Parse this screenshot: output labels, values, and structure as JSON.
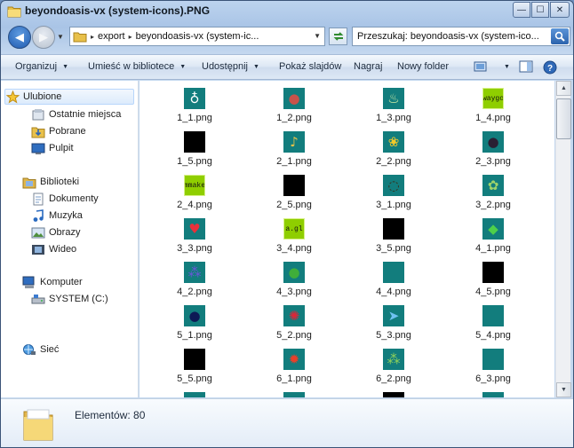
{
  "window": {
    "title": "beyondoasis-vx (system-icons).PNG",
    "caption_minimize": "—",
    "caption_maximize": "☐",
    "caption_close": "✕"
  },
  "nav": {
    "back_glyph": "◀",
    "forward_glyph": "▶",
    "address_parts": [
      "export",
      "beyondoasis-vx (system-ic..."
    ],
    "search_value": "Przeszukaj: beyondoasis-vx (system-ico..."
  },
  "toolbar": {
    "organize": "Organizuj",
    "include_library": "Umieść w bibliotece",
    "share": "Udostępnij",
    "slideshow": "Pokaż slajdów",
    "burn": "Nagraj",
    "new_folder": "Nowy folder"
  },
  "navpane": {
    "favorites": "Ulubione",
    "recent": "Ostatnie miejsca",
    "downloads": "Pobrane",
    "desktop": "Pulpit",
    "libraries": "Biblioteki",
    "documents": "Dokumenty",
    "music": "Muzyka",
    "pictures": "Obrazy",
    "videos": "Wideo",
    "computer": "Komputer",
    "drive_c": "SYSTEM (C:)",
    "network": "Sieć"
  },
  "files": [
    {
      "name": "1_1.png",
      "thumb": "teal",
      "icon": "ring-icon"
    },
    {
      "name": "1_2.png",
      "thumb": "teal",
      "icon": "meat-icon"
    },
    {
      "name": "1_3.png",
      "thumb": "teal",
      "icon": "potion-icon"
    },
    {
      "name": "1_4.png",
      "thumb": "green",
      "icon": "text-strip-icon",
      "text": "waygo"
    },
    {
      "name": "1_5.png",
      "thumb": "black",
      "icon": "blank-icon"
    },
    {
      "name": "2_1.png",
      "thumb": "teal",
      "icon": "horn-icon"
    },
    {
      "name": "2_2.png",
      "thumb": "teal",
      "icon": "bean-icon"
    },
    {
      "name": "2_3.png",
      "thumb": "teal",
      "icon": "bomb-icon"
    },
    {
      "name": "2_4.png",
      "thumb": "green",
      "icon": "text-strip-icon",
      "text": "mmake"
    },
    {
      "name": "2_5.png",
      "thumb": "black",
      "icon": "blank-icon"
    },
    {
      "name": "3_1.png",
      "thumb": "teal",
      "icon": "amulet-icon"
    },
    {
      "name": "3_2.png",
      "thumb": "teal",
      "icon": "herb-icon"
    },
    {
      "name": "3_3.png",
      "thumb": "teal",
      "icon": "heart-icon"
    },
    {
      "name": "3_4.png",
      "thumb": "green",
      "icon": "text-strip-icon",
      "text": "a.gl"
    },
    {
      "name": "3_5.png",
      "thumb": "black",
      "icon": "blank-icon"
    },
    {
      "name": "4_1.png",
      "thumb": "teal",
      "icon": "gem-icon"
    },
    {
      "name": "4_2.png",
      "thumb": "teal",
      "icon": "grapes-icon"
    },
    {
      "name": "4_3.png",
      "thumb": "teal",
      "icon": "green-fruit-icon"
    },
    {
      "name": "4_4.png",
      "thumb": "teal",
      "icon": "blank-icon"
    },
    {
      "name": "4_5.png",
      "thumb": "black",
      "icon": "blank-icon"
    },
    {
      "name": "5_1.png",
      "thumb": "teal",
      "icon": "egg-icon"
    },
    {
      "name": "5_2.png",
      "thumb": "teal",
      "icon": "berry-icon"
    },
    {
      "name": "5_3.png",
      "thumb": "teal",
      "icon": "fish-icon"
    },
    {
      "name": "5_4.png",
      "thumb": "teal",
      "icon": "blank-icon"
    },
    {
      "name": "5_5.png",
      "thumb": "black",
      "icon": "blank-icon"
    },
    {
      "name": "6_1.png",
      "thumb": "teal",
      "icon": "red-orb-icon"
    },
    {
      "name": "6_2.png",
      "thumb": "teal",
      "icon": "green-grapes-icon"
    },
    {
      "name": "6_3.png",
      "thumb": "teal",
      "icon": "blank-icon"
    },
    {
      "name": "",
      "thumb": "teal",
      "icon": "blank-icon"
    },
    {
      "name": "",
      "thumb": "teal",
      "icon": "blank-icon"
    },
    {
      "name": "",
      "thumb": "black",
      "icon": "blank-icon"
    },
    {
      "name": "",
      "thumb": "teal",
      "icon": "blank-icon"
    }
  ],
  "details": {
    "item_count": "Elementów: 80"
  },
  "colors": {
    "teal": "#127d7d",
    "black": "#000000",
    "green": "#8fce00",
    "selection": "#dcebfc",
    "accent": "#2b63ad"
  }
}
